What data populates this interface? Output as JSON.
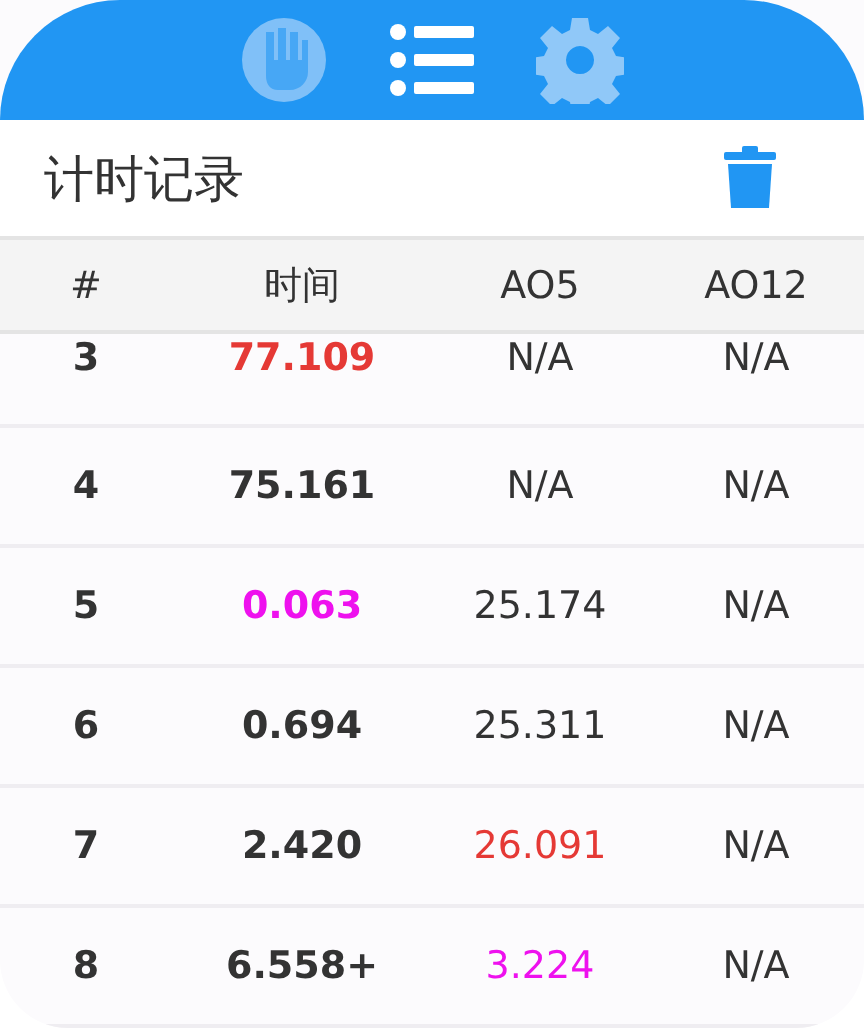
{
  "tabs": [
    {
      "kind": "hand",
      "selected": false
    },
    {
      "kind": "list",
      "selected": true
    },
    {
      "kind": "gear",
      "selected": false
    }
  ],
  "title": "计时记录",
  "table": {
    "columns": [
      "#",
      "时间",
      "AO5",
      "AO12"
    ],
    "rows": [
      {
        "cells": [
          {
            "text": "3",
            "color": "#333333"
          },
          {
            "text": "77.109",
            "color": "#e53935"
          },
          {
            "text": "N/A",
            "color": "#333333"
          },
          {
            "text": "N/A",
            "color": "#333333"
          }
        ]
      },
      {
        "cells": [
          {
            "text": "4",
            "color": "#333333"
          },
          {
            "text": "75.161",
            "color": "#333333"
          },
          {
            "text": "N/A",
            "color": "#333333"
          },
          {
            "text": "N/A",
            "color": "#333333"
          }
        ]
      },
      {
        "cells": [
          {
            "text": "5",
            "color": "#333333"
          },
          {
            "text": "0.063",
            "color": "#ee11ee"
          },
          {
            "text": "25.174",
            "color": "#333333"
          },
          {
            "text": "N/A",
            "color": "#333333"
          }
        ]
      },
      {
        "cells": [
          {
            "text": "6",
            "color": "#333333"
          },
          {
            "text": "0.694",
            "color": "#333333"
          },
          {
            "text": "25.311",
            "color": "#333333"
          },
          {
            "text": "N/A",
            "color": "#333333"
          }
        ]
      },
      {
        "cells": [
          {
            "text": "7",
            "color": "#333333"
          },
          {
            "text": "2.420",
            "color": "#333333"
          },
          {
            "text": "26.091",
            "color": "#e53935"
          },
          {
            "text": "N/A",
            "color": "#333333"
          }
        ]
      },
      {
        "cells": [
          {
            "text": "8",
            "color": "#333333"
          },
          {
            "text": "6.558+",
            "color": "#333333"
          },
          {
            "text": "3.224",
            "color": "#ee11ee"
          },
          {
            "text": "N/A",
            "color": "#333333"
          }
        ]
      }
    ]
  }
}
